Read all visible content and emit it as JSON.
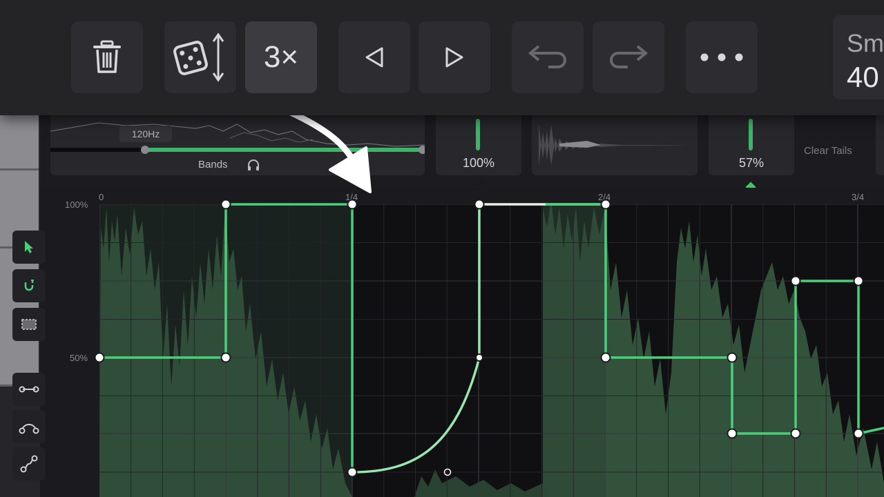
{
  "toolbar": {
    "buttons": [
      {
        "name": "delete",
        "icon": "trash-icon"
      },
      {
        "name": "randomize",
        "icon": "dice-vertical-icon"
      },
      {
        "name": "multiplier",
        "label": "3×"
      },
      {
        "name": "previous",
        "icon": "triangle-left-icon"
      },
      {
        "name": "next",
        "icon": "triangle-right-icon"
      },
      {
        "name": "undo",
        "icon": "undo-arrow-icon"
      },
      {
        "name": "redo",
        "icon": "redo-arrow-icon"
      },
      {
        "name": "more",
        "icon": "ellipsis-icon"
      }
    ],
    "smooth_label": "Sm",
    "smooth_value": "40"
  },
  "panels": {
    "bands": {
      "freq": "120Hz",
      "label": "Bands",
      "icon": "headphones-icon"
    },
    "mix_value": "100%",
    "tails_value": "57%",
    "clear_tails": "Clear Tails"
  },
  "editor": {
    "y_labels": [
      "100%",
      "50%"
    ],
    "x_labels": [
      "0",
      "1/4",
      "2/4",
      "3/4"
    ],
    "side_tools": [
      "cursor-icon",
      "magnet-icon",
      "select-rect-icon",
      "line-tool-icon",
      "curve-tool-icon",
      "s-curve-tool-icon"
    ]
  },
  "colors": {
    "accent": "#4ad07a",
    "accent_light": "#9ae6b0",
    "background": "#17171a",
    "toolbar": "#242427"
  }
}
